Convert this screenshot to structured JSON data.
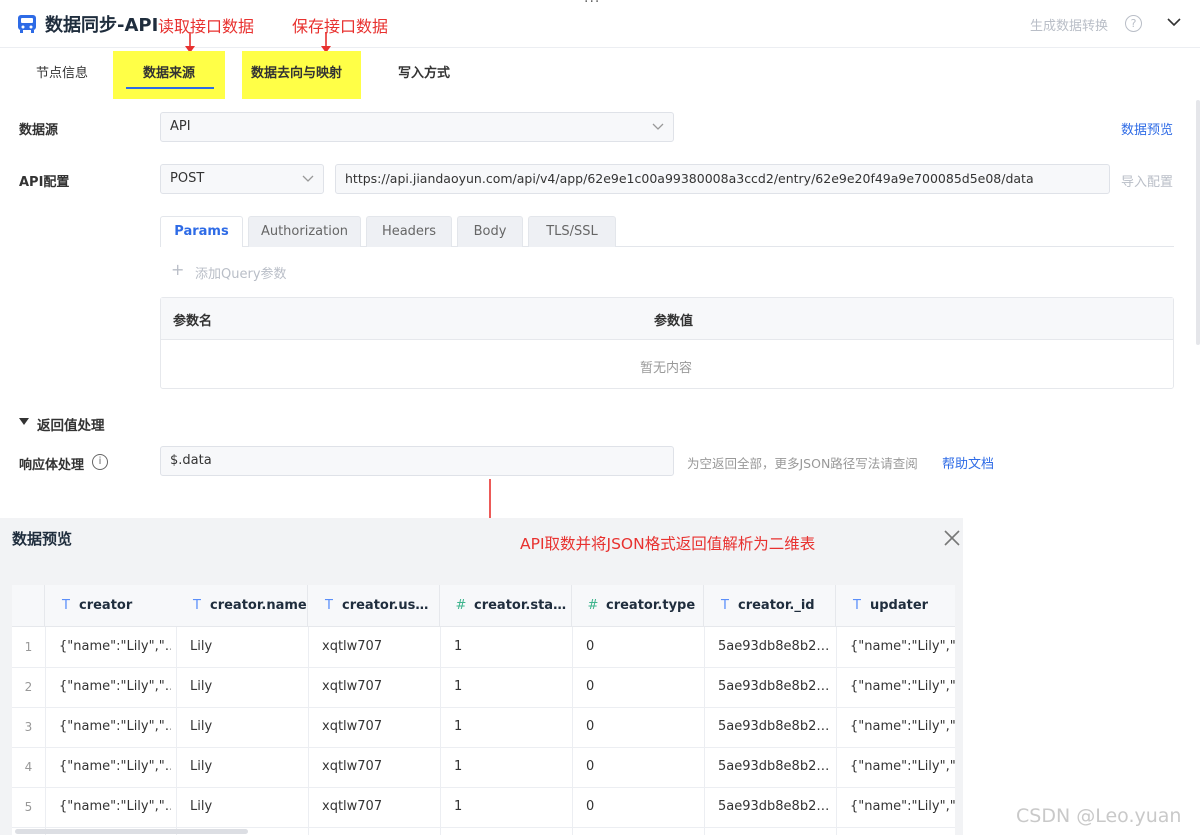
{
  "header": {
    "title": "数据同步-API",
    "more": "···",
    "generate_button": "生成数据转换",
    "help_glyph": "?"
  },
  "annotations": {
    "read_api": "读取接口数据",
    "save_api": "保存接口数据",
    "parse_note": "API取数并将JSON格式返回值解析为二维表"
  },
  "tabs": [
    {
      "label": "节点信息"
    },
    {
      "label": "数据来源"
    },
    {
      "label": "数据去向与映射"
    },
    {
      "label": "写入方式"
    }
  ],
  "form": {
    "datasource_label": "数据源",
    "datasource_value": "API",
    "preview_link": "数据预览",
    "api_config_label": "API配置",
    "method_value": "POST",
    "url_value": "https://api.jiandaoyun.com/api/v4/app/62e9e1c00a99380008a3ccd2/entry/62e9e20f49a9e700085d5e08/data",
    "import_config": "导入配置"
  },
  "subtabs": [
    {
      "label": "Params"
    },
    {
      "label": "Authorization"
    },
    {
      "label": "Headers"
    },
    {
      "label": "Body"
    },
    {
      "label": "TLS/SSL"
    }
  ],
  "params": {
    "add_query": "添加Query参数",
    "add_glyph": "+",
    "col_name": "参数名",
    "col_value": "参数值",
    "empty": "暂无内容"
  },
  "return_section": {
    "title": "返回值处理",
    "response_label": "响应体处理",
    "info_glyph": "i",
    "response_value": "$.data",
    "hint": "为空返回全部，更多JSON路径写法请查阅",
    "help_link": "帮助文档"
  },
  "preview": {
    "title": "数据预览",
    "columns": [
      {
        "name": "creator",
        "type": "text",
        "glyph": "T"
      },
      {
        "name": "creator.name",
        "type": "text",
        "glyph": "T"
      },
      {
        "name": "creator.us…",
        "type": "text",
        "glyph": "T"
      },
      {
        "name": "creator.sta…",
        "type": "number",
        "glyph": "#"
      },
      {
        "name": "creator.type",
        "type": "number",
        "glyph": "#"
      },
      {
        "name": "creator._id",
        "type": "text",
        "glyph": "T"
      },
      {
        "name": "updater",
        "type": "text",
        "glyph": "T"
      }
    ],
    "rows": [
      {
        "num": "1",
        "cells": [
          "{\"name\":\"Lily\",\"…",
          "Lily",
          "xqtlw707",
          "1",
          "0",
          "5ae93db8e8b2…",
          "{\"name\":\"Lily\",\"…"
        ]
      },
      {
        "num": "2",
        "cells": [
          "{\"name\":\"Lily\",\"…",
          "Lily",
          "xqtlw707",
          "1",
          "0",
          "5ae93db8e8b2…",
          "{\"name\":\"Lily\",\"…"
        ]
      },
      {
        "num": "3",
        "cells": [
          "{\"name\":\"Lily\",\"…",
          "Lily",
          "xqtlw707",
          "1",
          "0",
          "5ae93db8e8b2…",
          "{\"name\":\"Lily\",\"…"
        ]
      },
      {
        "num": "4",
        "cells": [
          "{\"name\":\"Lily\",\"…",
          "Lily",
          "xqtlw707",
          "1",
          "0",
          "5ae93db8e8b2…",
          "{\"name\":\"Lily\",\"…"
        ]
      },
      {
        "num": "5",
        "cells": [
          "{\"name\":\"Lily\",\"…",
          "Lily",
          "xqtlw707",
          "1",
          "0",
          "5ae93db8e8b2…",
          "{\"name\":\"Lily\",\"…"
        ]
      }
    ]
  },
  "watermark": "CSDN @Leo.yuan",
  "colors": {
    "accent": "#2e6be6",
    "annotation": "#e8312f",
    "highlight": "#ffff47"
  }
}
